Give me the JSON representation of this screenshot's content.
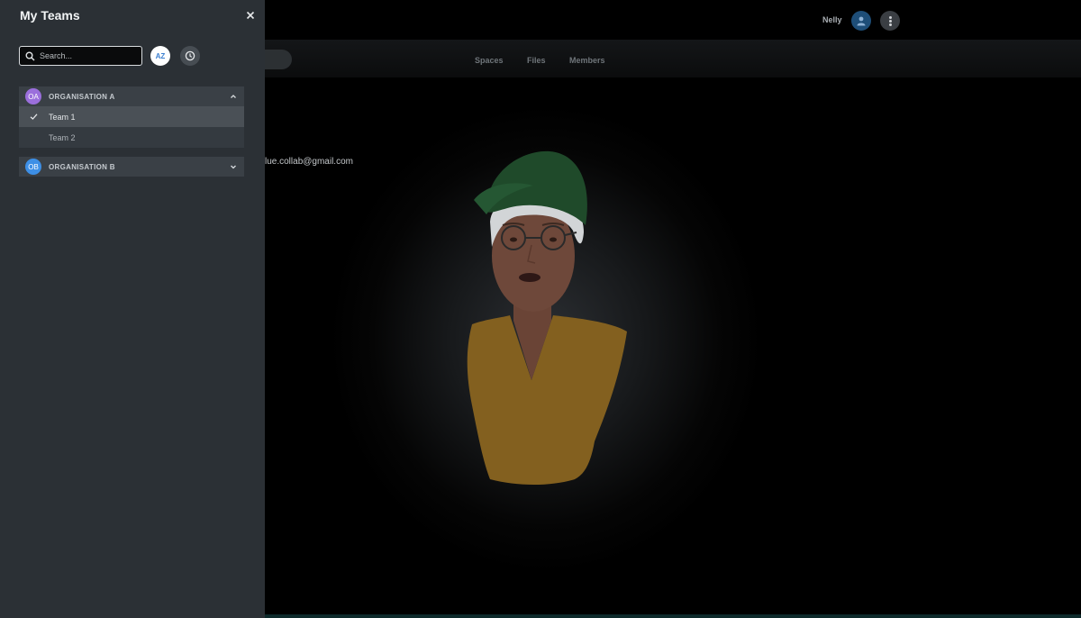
{
  "header": {
    "user_name": "Nelly",
    "avatar_icon": "user-icon",
    "more_icon": "more-vertical-icon"
  },
  "nav": {
    "tabs": [
      {
        "label": "Spaces"
      },
      {
        "label": "Files"
      },
      {
        "label": "Members"
      }
    ]
  },
  "profile": {
    "email_partial": "lue.collab@gmail.com"
  },
  "panel": {
    "title": "My Teams",
    "close_icon": "close-icon",
    "search": {
      "placeholder": "Search...",
      "value": ""
    },
    "sort_az_label": "AZ",
    "recent_icon": "clock-icon",
    "organisations": [
      {
        "initials": "OA",
        "name": "ORGANISATION A",
        "expanded": true,
        "color": "#9b6fdc",
        "teams": [
          {
            "label": "Team 1",
            "selected": true
          },
          {
            "label": "Team 2",
            "selected": false
          }
        ]
      },
      {
        "initials": "OB",
        "name": "ORGANISATION B",
        "expanded": false,
        "color": "#3d8fe6",
        "teams": []
      }
    ]
  },
  "colors": {
    "panel_bg": "#2b3035",
    "org_bg": "#3a4046",
    "selected_row": "#4a5056",
    "accent_blue": "#3b7fd0"
  }
}
